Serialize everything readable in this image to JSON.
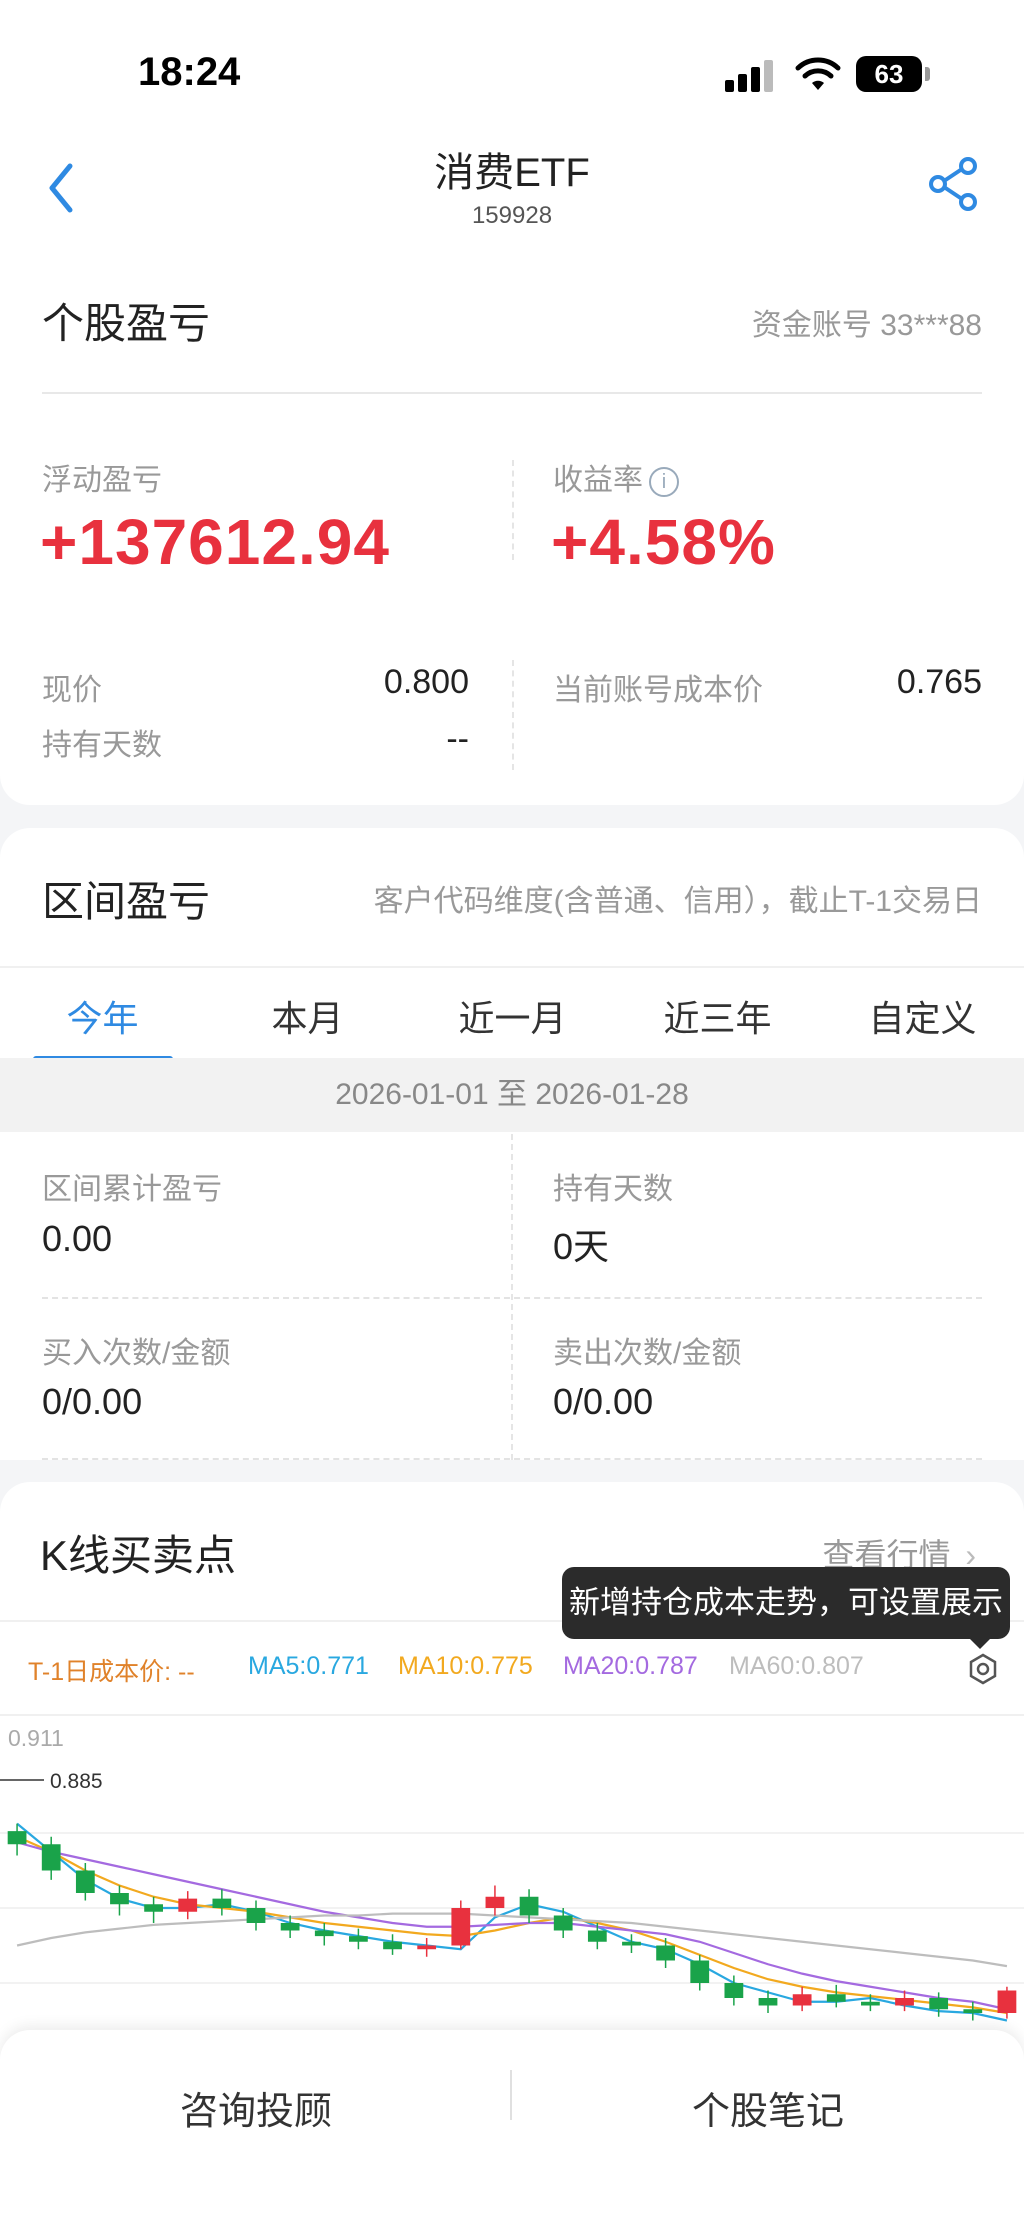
{
  "status_bar": {
    "time": "18:24",
    "battery": "63"
  },
  "nav": {
    "title": "消费ETF",
    "code": "159928"
  },
  "holding": {
    "title": "个股盈亏",
    "account": "资金账号 33***88",
    "float_pl_label": "浮动盈亏",
    "float_pl_value": "+137612.94",
    "return_label": "收益率",
    "return_value": "+4.58%",
    "price_label": "现价",
    "price_value": "0.800",
    "days_label": "持有天数",
    "days_value": "--",
    "cost_label": "当前账号成本价",
    "cost_value": "0.765"
  },
  "range": {
    "title": "区间盈亏",
    "note": "客户代码维度(含普通、信用），截止T-1交易日",
    "tabs": [
      "今年",
      "本月",
      "近一月",
      "近三年",
      "自定义"
    ],
    "active_tab": 0,
    "date_range": "2026-01-01 至 2026-01-28",
    "cum_pl_label": "区间累计盈亏",
    "cum_pl_value": "0.00",
    "hold_days_label": "持有天数",
    "hold_days_value": "0天",
    "buy_label": "买入次数/金额",
    "buy_value": "0/0.00",
    "sell_label": "卖出次数/金额",
    "sell_value": "0/0.00"
  },
  "kline": {
    "title": "K线买卖点",
    "more_label": "查看行情",
    "tooltip": "新增持仓成本走势，可设置展示",
    "legend": {
      "cost": "T-1日成本价: --",
      "ma5": "MA5:0.771",
      "ma10": "MA10:0.775",
      "ma20": "MA20:0.787",
      "ma60": "MA60:0.807"
    },
    "max_label": "0.911",
    "high_label": "0.885",
    "colors": {
      "up": "#e8313e",
      "down": "#1aa34a",
      "ma5": "#29a8e0",
      "ma10": "#f2a91f",
      "ma20": "#a46ae0",
      "ma60": "#bdbdbd",
      "cost": "#e0822a"
    }
  },
  "bottom": {
    "left": "咨询投顾",
    "right": "个股笔记"
  },
  "chart_data": {
    "type": "candlestick",
    "title": "",
    "ylim": [
      0.76,
      0.92
    ],
    "annotations": [
      "0.911",
      "0.885"
    ],
    "series": [
      {
        "name": "MA5",
        "values": [
          0.885,
          0.87,
          0.855,
          0.845,
          0.84,
          0.84,
          0.842,
          0.838,
          0.832,
          0.828,
          0.825,
          0.822,
          0.82,
          0.818,
          0.835,
          0.842,
          0.838,
          0.83,
          0.822,
          0.818,
          0.81,
          0.8,
          0.795,
          0.79,
          0.79,
          0.792,
          0.788,
          0.785,
          0.784,
          0.78
        ]
      },
      {
        "name": "MA10",
        "values": [
          0.878,
          0.87,
          0.86,
          0.852,
          0.846,
          0.842,
          0.84,
          0.838,
          0.835,
          0.832,
          0.83,
          0.828,
          0.826,
          0.825,
          0.828,
          0.832,
          0.835,
          0.832,
          0.828,
          0.822,
          0.815,
          0.808,
          0.802,
          0.798,
          0.795,
          0.793,
          0.791,
          0.789,
          0.787,
          0.784
        ]
      },
      {
        "name": "MA20",
        "values": [
          0.875,
          0.87,
          0.866,
          0.862,
          0.858,
          0.854,
          0.85,
          0.846,
          0.842,
          0.838,
          0.835,
          0.832,
          0.83,
          0.83,
          0.831,
          0.832,
          0.832,
          0.83,
          0.828,
          0.826,
          0.822,
          0.816,
          0.81,
          0.805,
          0.801,
          0.798,
          0.795,
          0.792,
          0.79,
          0.786
        ]
      },
      {
        "name": "MA60",
        "values": [
          0.82,
          0.824,
          0.827,
          0.829,
          0.831,
          0.832,
          0.833,
          0.834,
          0.835,
          0.836,
          0.836,
          0.837,
          0.837,
          0.837,
          0.836,
          0.835,
          0.834,
          0.833,
          0.832,
          0.83,
          0.828,
          0.826,
          0.824,
          0.822,
          0.82,
          0.818,
          0.816,
          0.814,
          0.812,
          0.809
        ]
      }
    ],
    "candles": [
      {
        "o": 0.881,
        "c": 0.874,
        "h": 0.885,
        "l": 0.868
      },
      {
        "o": 0.874,
        "c": 0.86,
        "h": 0.878,
        "l": 0.855
      },
      {
        "o": 0.86,
        "c": 0.848,
        "h": 0.864,
        "l": 0.844
      },
      {
        "o": 0.848,
        "c": 0.842,
        "h": 0.852,
        "l": 0.836
      },
      {
        "o": 0.842,
        "c": 0.838,
        "h": 0.846,
        "l": 0.832
      },
      {
        "o": 0.838,
        "c": 0.845,
        "h": 0.849,
        "l": 0.834
      },
      {
        "o": 0.845,
        "c": 0.84,
        "h": 0.85,
        "l": 0.836
      },
      {
        "o": 0.84,
        "c": 0.832,
        "h": 0.844,
        "l": 0.828
      },
      {
        "o": 0.832,
        "c": 0.828,
        "h": 0.836,
        "l": 0.824
      },
      {
        "o": 0.828,
        "c": 0.825,
        "h": 0.832,
        "l": 0.82
      },
      {
        "o": 0.825,
        "c": 0.822,
        "h": 0.829,
        "l": 0.818
      },
      {
        "o": 0.822,
        "c": 0.818,
        "h": 0.826,
        "l": 0.815
      },
      {
        "o": 0.818,
        "c": 0.82,
        "h": 0.824,
        "l": 0.814
      },
      {
        "o": 0.82,
        "c": 0.84,
        "h": 0.844,
        "l": 0.818
      },
      {
        "o": 0.84,
        "c": 0.846,
        "h": 0.852,
        "l": 0.836
      },
      {
        "o": 0.846,
        "c": 0.836,
        "h": 0.85,
        "l": 0.832
      },
      {
        "o": 0.836,
        "c": 0.828,
        "h": 0.84,
        "l": 0.824
      },
      {
        "o": 0.828,
        "c": 0.822,
        "h": 0.832,
        "l": 0.818
      },
      {
        "o": 0.822,
        "c": 0.82,
        "h": 0.826,
        "l": 0.816
      },
      {
        "o": 0.82,
        "c": 0.812,
        "h": 0.824,
        "l": 0.808
      },
      {
        "o": 0.812,
        "c": 0.8,
        "h": 0.815,
        "l": 0.796
      },
      {
        "o": 0.8,
        "c": 0.792,
        "h": 0.804,
        "l": 0.788
      },
      {
        "o": 0.792,
        "c": 0.788,
        "h": 0.796,
        "l": 0.784
      },
      {
        "o": 0.788,
        "c": 0.794,
        "h": 0.798,
        "l": 0.785
      },
      {
        "o": 0.794,
        "c": 0.79,
        "h": 0.799,
        "l": 0.787
      },
      {
        "o": 0.79,
        "c": 0.788,
        "h": 0.794,
        "l": 0.785
      },
      {
        "o": 0.788,
        "c": 0.792,
        "h": 0.796,
        "l": 0.785
      },
      {
        "o": 0.792,
        "c": 0.786,
        "h": 0.795,
        "l": 0.782
      },
      {
        "o": 0.786,
        "c": 0.784,
        "h": 0.79,
        "l": 0.78
      },
      {
        "o": 0.784,
        "c": 0.796,
        "h": 0.798,
        "l": 0.781
      }
    ]
  }
}
